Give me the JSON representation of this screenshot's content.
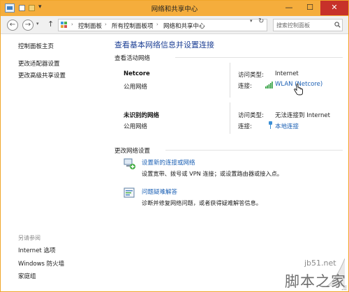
{
  "window": {
    "title": "网络和共享中心",
    "minimize_glyph": "—",
    "maximize_glyph": "☐",
    "close_glyph": "✕",
    "close_color": "#c7312a",
    "titlebar_color": "#f5ad3c"
  },
  "address_bar": {
    "back_glyph": "←",
    "forward_glyph": "→",
    "dropdown_glyph": "▾",
    "up_glyph": "↑",
    "separator_glyph": "›",
    "crumbs": [
      "控制面板",
      "所有控制面板项",
      "网络和共享中心"
    ],
    "refresh_glyph": "↻",
    "search_placeholder": "搜索控制面板"
  },
  "sidebar": {
    "links": [
      "控制面板主页",
      "更改适配器设置",
      "更改高级共享设置"
    ],
    "see_also_heading": "另请参阅",
    "see_also_links": [
      "Internet 选项",
      "Windows 防火墙",
      "家庭组"
    ]
  },
  "main": {
    "title": "查看基本网络信息并设置连接",
    "active_networks_heading": "查看活动网络",
    "networks": [
      {
        "name": "Netcore",
        "category": "公用网络",
        "access_type_label": "访问类型:",
        "access_type_value": "Internet",
        "connection_label": "连接:",
        "connection_value": "WLAN (Netcore)",
        "connection_icon": "wifi-signal-icon"
      },
      {
        "name": "未识别的网络",
        "category": "公用网络",
        "access_type_label": "访问类型:",
        "access_type_value": "无法连接到 Internet",
        "connection_label": "连接:",
        "connection_value": "本地连接",
        "connection_icon": "ethernet-icon"
      }
    ],
    "change_settings_heading": "更改网络设置",
    "tasks": [
      {
        "link": "设置新的连接或网络",
        "description": "设置宽带、拨号或 VPN 连接；或设置路由器或接入点。",
        "icon": "new-connection-icon"
      },
      {
        "link": "问题疑难解答",
        "description": "诊断并修复网络问题，或者获得疑难解答信息。",
        "icon": "troubleshoot-icon"
      }
    ]
  },
  "watermark": {
    "url": "jb51.net",
    "name": "脚本之家"
  },
  "colors": {
    "link": "#1a5fb4",
    "title": "#1c3f94",
    "wifi_green": "#2e9e3e"
  }
}
